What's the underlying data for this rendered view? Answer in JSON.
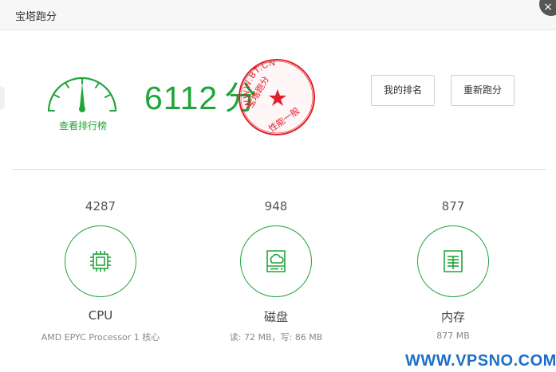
{
  "window": {
    "title": "宝塔跑分",
    "close_glyph": "×"
  },
  "score": {
    "value": "6112",
    "unit": "分",
    "ranking_link": "查看排行榜"
  },
  "stamp": {
    "text": "WWW.BT.CN",
    "rank_text": "性能一般",
    "left_text": "宝塔跑分",
    "color": "#e0202a"
  },
  "buttons": {
    "my_rank": "我的排名",
    "retest": "重新跑分"
  },
  "metrics": [
    {
      "value": "4287",
      "name": "CPU",
      "info": "AMD EPYC Processor 1 核心",
      "icon": "cpu-icon"
    },
    {
      "value": "948",
      "name": "磁盘",
      "info": "读: 72 MB，写: 86 MB",
      "icon": "disk-icon"
    },
    {
      "value": "877",
      "name": "内存",
      "info": "877 MB",
      "icon": "memory-icon"
    }
  ],
  "watermark": "WWW.VPSNO.COM",
  "colors": {
    "accent": "#20a53a",
    "stamp": "#e0202a",
    "watermark": "#1e6fc8"
  }
}
